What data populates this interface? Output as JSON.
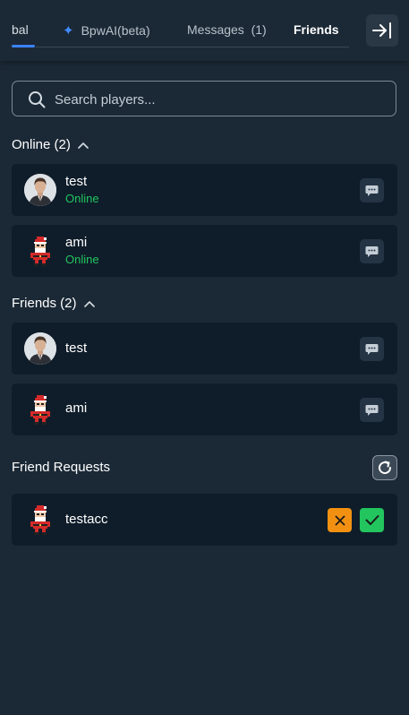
{
  "tabs": {
    "global_label": "bal",
    "ai_label": "BpwAI(beta)",
    "messages_label": "Messages  (1)",
    "friends_label": "Friends"
  },
  "search": {
    "placeholder": "Search players..."
  },
  "online_section": {
    "title": "Online (2)",
    "users": [
      {
        "name": "test",
        "status": "Online",
        "avatar": "man-portrait"
      },
      {
        "name": "ami",
        "status": "Online",
        "avatar": "santa-sprite"
      }
    ]
  },
  "friends_section": {
    "title": "Friends (2)",
    "users": [
      {
        "name": "test",
        "avatar": "man-portrait"
      },
      {
        "name": "ami",
        "avatar": "santa-sprite"
      }
    ]
  },
  "requests_section": {
    "title": "Friend Requests",
    "requests": [
      {
        "name": "testacc",
        "avatar": "santa-sprite"
      }
    ]
  },
  "colors": {
    "background": "#1b2936",
    "card": "#0f1d2a",
    "accent": "#3b82f6",
    "online": "#22c55e",
    "decline": "#f29111",
    "accept": "#22c55e"
  }
}
